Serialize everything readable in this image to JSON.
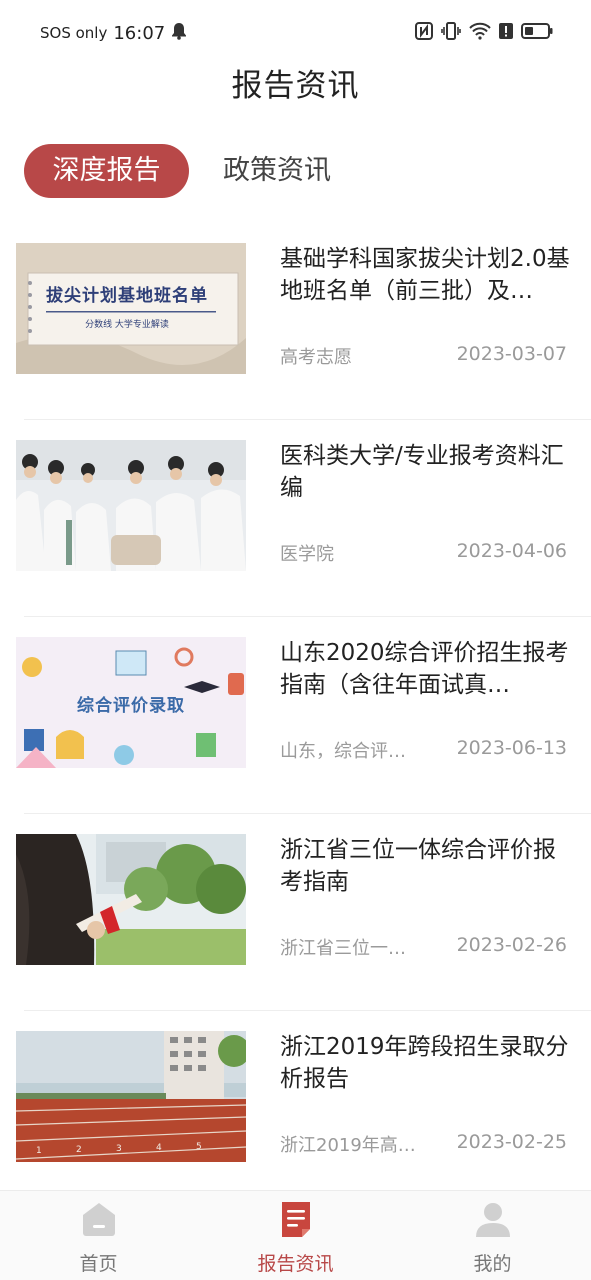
{
  "status_bar": {
    "carrier": "SOS only",
    "time": "16:07"
  },
  "header": {
    "title": "报告资讯"
  },
  "tabs": [
    {
      "label": "深度报告",
      "active": true
    },
    {
      "label": "政策资讯",
      "active": false
    }
  ],
  "articles": [
    {
      "title": "基础学科国家拔尖计划2.0基地班名单（前三批）及…",
      "tag": "高考志愿",
      "date": "2023-03-07",
      "thumb_text": "拔尖计划基地班名单",
      "thumb_subtext": "分数线 大学专业解读"
    },
    {
      "title": "医科类大学/专业报考资料汇编",
      "tag": "医学院",
      "date": "2023-04-06"
    },
    {
      "title": "山东2020综合评价招生报考指南（含往年面试真…",
      "tag": "山东，综合评…",
      "date": "2023-06-13",
      "thumb_text": "综合评价录取"
    },
    {
      "title": "浙江省三位一体综合评价报考指南",
      "tag": "浙江省三位一…",
      "date": "2023-02-26"
    },
    {
      "title": "浙江2019年跨段招生录取分析报告",
      "tag": "浙江2019年高…",
      "date": "2023-02-25"
    }
  ],
  "bottom_nav": [
    {
      "label": "首页",
      "icon": "home-icon",
      "active": false
    },
    {
      "label": "报告资讯",
      "icon": "report-icon",
      "active": true
    },
    {
      "label": "我的",
      "icon": "profile-icon",
      "active": false
    }
  ],
  "colors": {
    "accent": "#b84848",
    "text": "#222222",
    "muted": "#9a9a9a"
  }
}
